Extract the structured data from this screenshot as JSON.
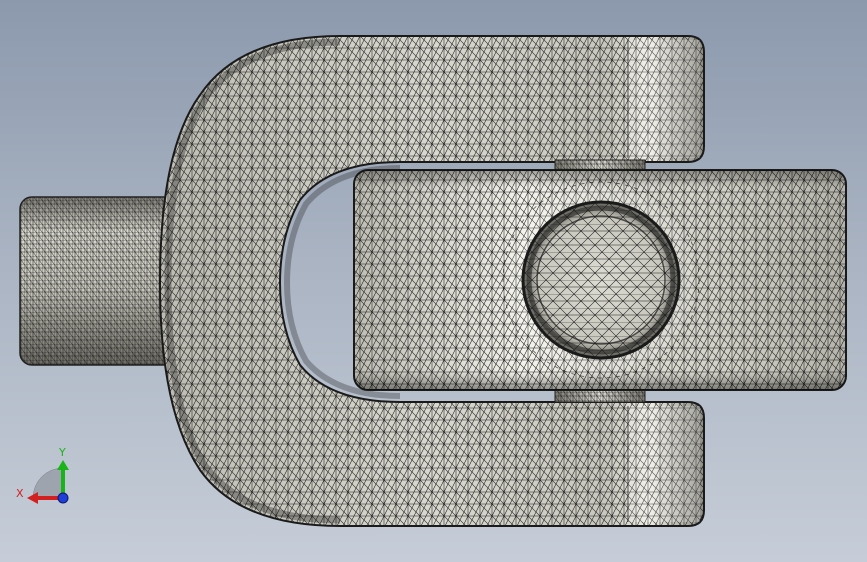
{
  "viewport": {
    "model": "universal-joint-yoke-mesh",
    "display_mode": "shaded-with-mesh"
  },
  "triad": {
    "x_label": "X",
    "y_label": "Y",
    "x_color": "#d22020",
    "y_color": "#18b418",
    "z_color": "#1f3fd8"
  },
  "colors": {
    "background_top": "#8c99ad",
    "background_bottom": "#c6cdd8",
    "mesh_line": "#1a1a1a",
    "surface_light": "#f3f2ea",
    "surface_dark": "#6b6a62"
  }
}
